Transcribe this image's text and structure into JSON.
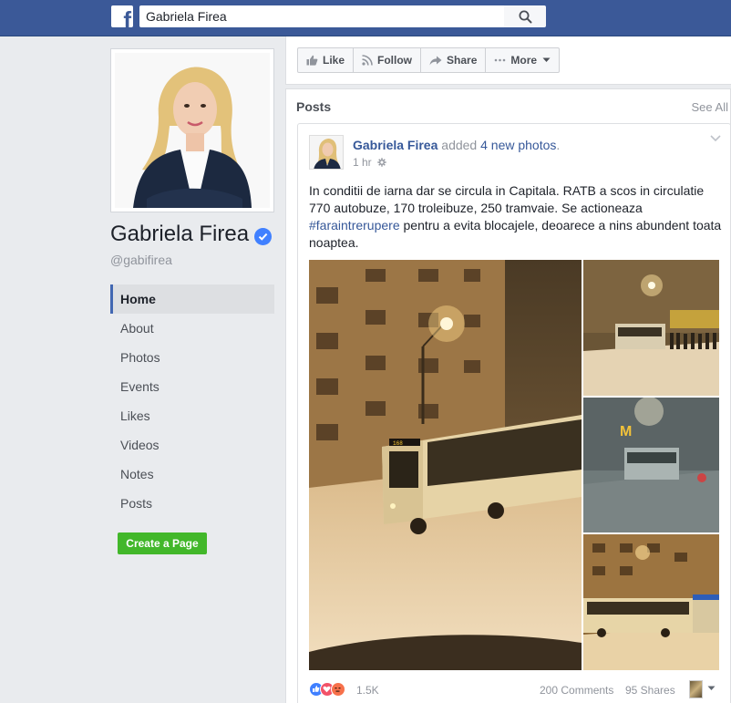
{
  "topbar": {
    "logo_letter": "f",
    "search_value": "Gabriela Firea",
    "search_icon": "search-icon"
  },
  "profile": {
    "name": "Gabriela Firea",
    "handle": "@gabifirea",
    "verified_icon": "verified-badge-icon"
  },
  "nav": {
    "items": [
      {
        "label": "Home",
        "active": true
      },
      {
        "label": "About"
      },
      {
        "label": "Photos"
      },
      {
        "label": "Events"
      },
      {
        "label": "Likes"
      },
      {
        "label": "Videos"
      },
      {
        "label": "Notes"
      },
      {
        "label": "Posts"
      }
    ]
  },
  "create_page_label": "Create a Page",
  "actions": {
    "like": "Like",
    "follow": "Follow",
    "share": "Share",
    "more": "More"
  },
  "posts": {
    "title": "Posts",
    "see_all": "See All"
  },
  "post": {
    "author": "Gabriela Firea",
    "added": "added",
    "photos_link": "4 new photos",
    "period": ".",
    "time": "1 hr",
    "text_before": "In conditii de iarna dar se circula in Capitala. RATB a scos in circulatie 770 autobuze, 170 troleibuze, 250 tramvaie. Se actioneaza ",
    "hashtag": "#faraintrerupere",
    "text_after": " pentru a evita blocajele, deoarece a nins abundent toata noaptea.",
    "reactions_count": "1.5K",
    "comments": "200 Comments",
    "shares": "95 Shares"
  },
  "colors": {
    "brand": "#3b5998",
    "link": "#365899",
    "create_page_green": "#42b72a",
    "like_blue": "#4080ff",
    "love_red": "#f25268",
    "angry_orange": "#f7714b"
  }
}
